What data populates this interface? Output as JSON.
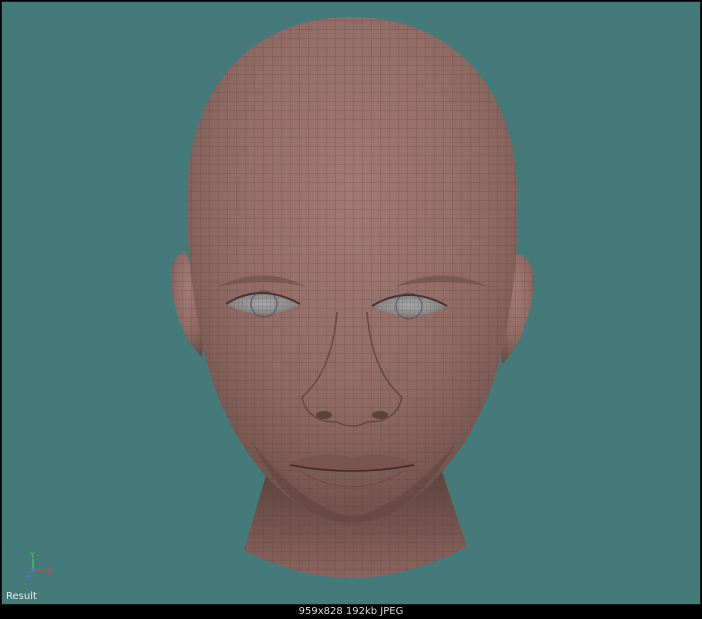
{
  "viewport": {
    "label": "Result",
    "background_color": "#447a7a",
    "skin_color": "#8f6a63",
    "wire_color": "#5a403c",
    "axis": {
      "y_label": "Y",
      "z_label": "Z",
      "x_label": "X"
    }
  },
  "status_bar": {
    "info": "959x828 192kb JPEG"
  }
}
